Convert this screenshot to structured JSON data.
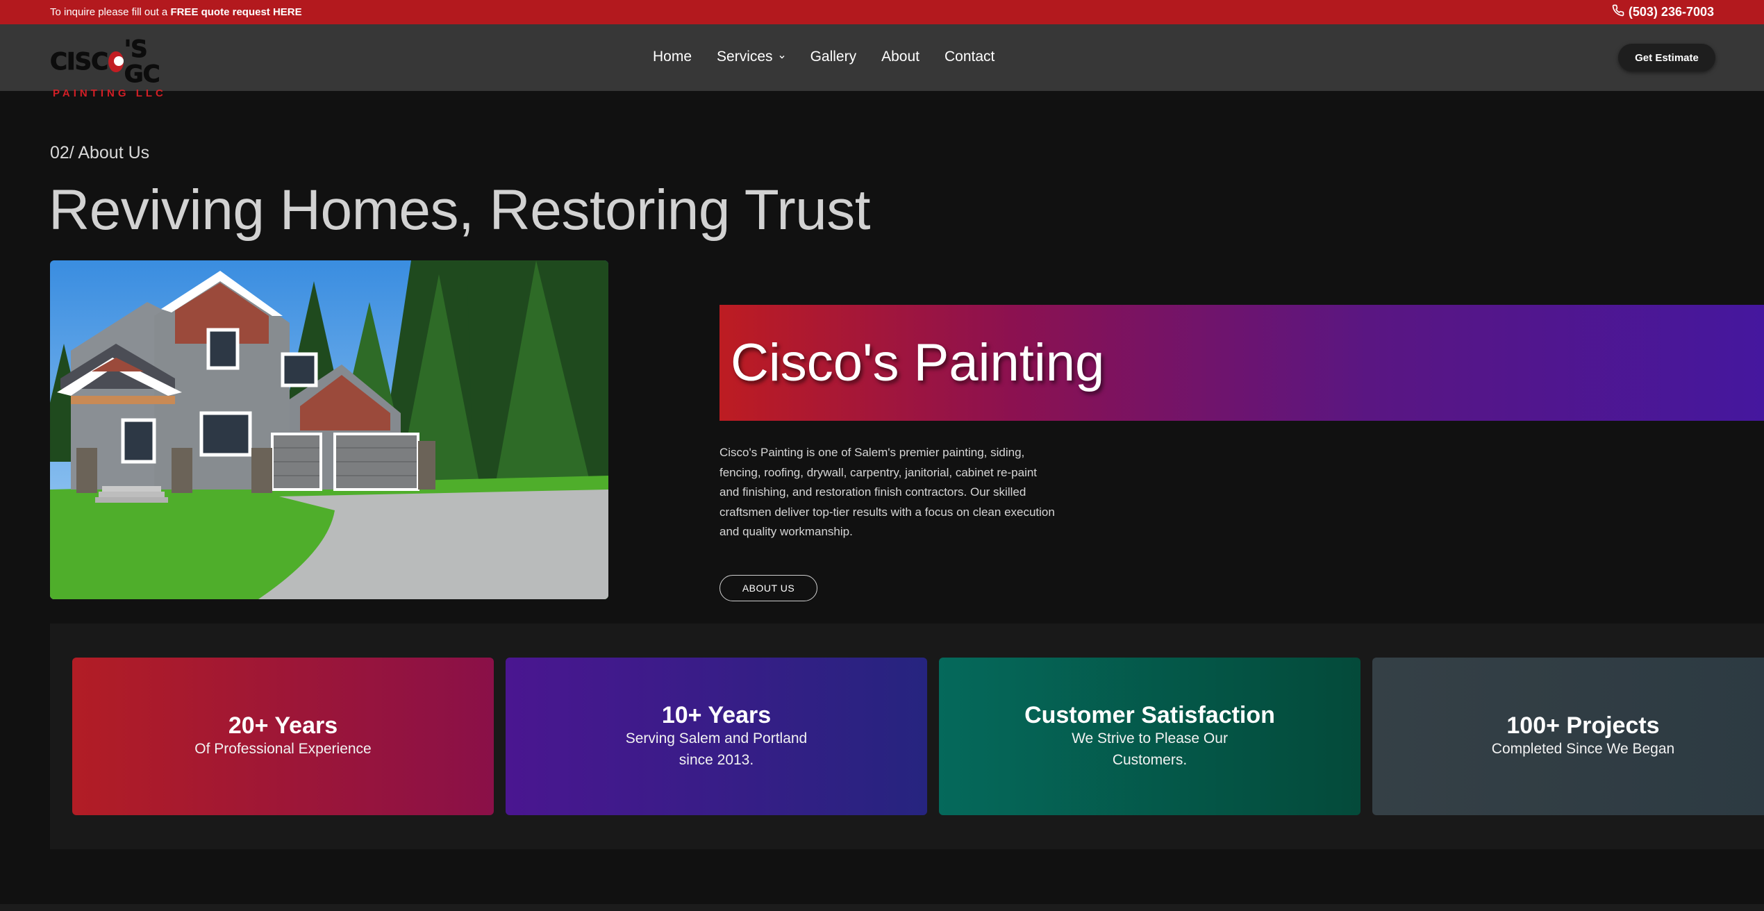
{
  "topbar": {
    "message_prefix": "To inquire please fill out a ",
    "message_link": "FREE quote request HERE",
    "phone": "(503) 236-7003",
    "bg_color": "#b3191e"
  },
  "logo": {
    "line1_a": "CISC",
    "line1_b": "'S GC",
    "line2": "PAINTING LLC"
  },
  "nav": {
    "items": [
      {
        "label": "Home"
      },
      {
        "label": "Services"
      },
      {
        "label": "Gallery"
      },
      {
        "label": "About"
      },
      {
        "label": "Contact"
      }
    ],
    "cta_label": "Get Estimate"
  },
  "hero": {
    "eyebrow": "02/ About Us",
    "headline": "Reviving Homes, Restoring Trust",
    "banner_title": "Cisco's Painting",
    "description": "Cisco's Painting is one of Salem's premier painting, siding, fencing, roofing, drywall, carpentry, janitorial, cabinet re-paint and finishing, and restoration finish contractors. Our skilled craftsmen deliver top-tier results with a focus on clean execution and quality workmanship.",
    "button_label": "ABOUT US"
  },
  "stats": [
    {
      "title": "20+ Years",
      "subtitle": "Of Professional Experience"
    },
    {
      "title": "10+ Years",
      "subtitle": "Serving Salem and Portland since 2013."
    },
    {
      "title": "Customer Satisfaction",
      "subtitle": "We Strive to Please Our Customers."
    },
    {
      "title": "100+ Projects",
      "subtitle": "Completed Since We Began"
    }
  ],
  "colors": {
    "brand_red": "#b3191e",
    "banner_gradient_start": "#bd1c22",
    "banner_gradient_end": "#45179e",
    "background": "#111111"
  }
}
